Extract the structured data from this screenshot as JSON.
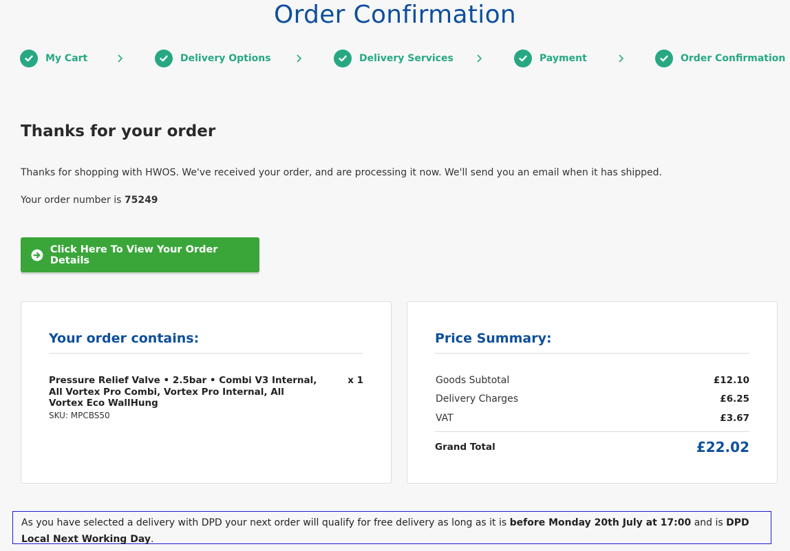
{
  "page_title": "Order Confirmation",
  "steps": [
    {
      "label": "My Cart"
    },
    {
      "label": "Delivery Options"
    },
    {
      "label": "Delivery Services"
    },
    {
      "label": "Payment"
    },
    {
      "label": "Order Confirmation"
    }
  ],
  "confirmation": {
    "heading": "Thanks for your order",
    "message": "Thanks for shopping with HWOS. We've received your order, and are processing it now. We'll send you an email when it has shipped.",
    "order_number_prefix": "Your order number is ",
    "order_number": "75249"
  },
  "view_button": {
    "label": "Click Here To View Your Order Details",
    "icon": "arrow-circle-right-icon"
  },
  "order_contents": {
    "title": "Your order contains:",
    "items": [
      {
        "name": "Pressure Relief Valve • 2.5bar • Combi V3 Internal, All Vortex Pro Combi, Vortex Pro Internal, All Vortex Eco WallHung",
        "sku": "SKU: MPCBS50",
        "qty": "x 1"
      }
    ]
  },
  "price_summary": {
    "title": "Price Summary:",
    "rows": [
      {
        "label": "Goods Subtotal",
        "value": "£12.10"
      },
      {
        "label": "Delivery Charges",
        "value": "£6.25"
      },
      {
        "label": "VAT",
        "value": "£3.67"
      }
    ],
    "grand_total_label": "Grand Total",
    "grand_total_value": "£22.02"
  },
  "delivery_notice": {
    "text1": "As you have selected a delivery with DPD your next order will qualify for free delivery as long as it is ",
    "bold1": "before Monday 20th July at 17:00",
    "text2": " and is ",
    "bold2": "DPD Local Next Working Day",
    "text3": "."
  },
  "colors": {
    "brand_blue": "#0d4f9c",
    "step_green": "#27a883",
    "button_green": "#3aa63a",
    "notice_border": "#1a1ad6"
  }
}
